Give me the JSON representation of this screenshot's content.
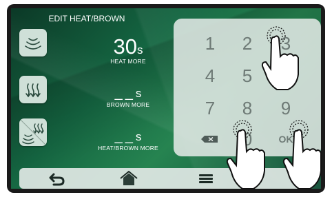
{
  "screen": {
    "title": "EDIT HEAT/BROWN",
    "rows": [
      {
        "icon": "heat-waves-icon",
        "value": "30",
        "unit": "s",
        "label": "HEAT MORE"
      },
      {
        "icon": "brown-arrows-icon",
        "value": "__",
        "unit": "s",
        "label": "BROWN MORE"
      },
      {
        "icon": "heat-brown-combined-icon",
        "value": "__",
        "unit": "s",
        "label": "HEAT/BROWN MORE"
      }
    ]
  },
  "keypad": {
    "keys": [
      "1",
      "2",
      "3",
      "4",
      "5",
      "6",
      "7",
      "8",
      "9",
      "delete",
      "0",
      "OK"
    ],
    "ok_label": "OK"
  },
  "navbar": {
    "items": [
      "back-icon",
      "home-icon",
      "menu-icon"
    ]
  },
  "colors": {
    "background_green": "#1f7a52",
    "panel": "#e1e8e5",
    "icon_dark": "#243a33",
    "key_text": "#6e7a76"
  }
}
